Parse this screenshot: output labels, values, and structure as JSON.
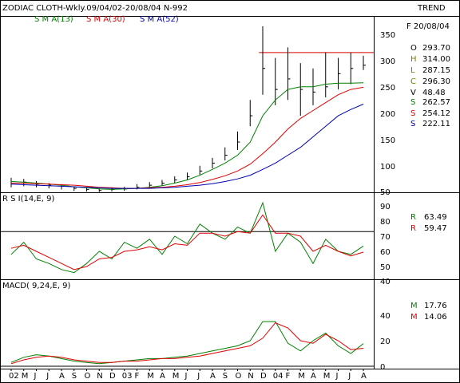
{
  "header": {
    "title": "ZODIAC CLOTH-Wkly.09/04/02-20/08/04  N-992",
    "trend_label": "TREND"
  },
  "colors": {
    "sma13": "#008000",
    "sma30": "#e00000",
    "sma52": "#0000b0",
    "price": "#000000",
    "rsi": "#008000",
    "rsi_signal": "#e00000",
    "macd": "#008000",
    "macd_signal": "#e00000",
    "ref_line": "#d00000"
  },
  "price_panel": {
    "sma_labels": [
      "S M A(13)",
      "S M A(30)",
      "S M A(52)"
    ],
    "ticks": [
      "350",
      "300",
      "250",
      "200",
      "150",
      "100",
      "50"
    ],
    "info": {
      "date": "F 20/08/04",
      "rows": [
        {
          "k": "O",
          "v": "293.70",
          "c": "#000000"
        },
        {
          "k": "H",
          "v": "314.00",
          "c": "#808000"
        },
        {
          "k": "L",
          "v": "287.15",
          "c": "#808000"
        },
        {
          "k": "C",
          "v": "296.30",
          "c": "#808000"
        },
        {
          "k": "V",
          "v": "48.48",
          "c": "#000000"
        },
        {
          "k": "S",
          "v": "262.57",
          "c": "#008000"
        },
        {
          "k": "S",
          "v": "254.12",
          "c": "#e00000"
        },
        {
          "k": "S",
          "v": "222.11",
          "c": "#0000b0"
        }
      ]
    }
  },
  "rsi_panel": {
    "label": "R S I(14,E, 9)",
    "ticks": [
      "90",
      "80",
      "70",
      "60",
      "50",
      "40"
    ],
    "info": [
      {
        "k": "R",
        "v": "63.49",
        "c": "#008000"
      },
      {
        "k": "R",
        "v": "59.47",
        "c": "#e00000"
      }
    ]
  },
  "macd_panel": {
    "label": "MACD( 9,24,E, 9)",
    "ticks": [
      "40",
      "20",
      "0"
    ],
    "info": [
      {
        "k": "M",
        "v": "17.76",
        "c": "#008000"
      },
      {
        "k": "M",
        "v": "14.06",
        "c": "#e00000"
      }
    ]
  },
  "x_axis": {
    "labels": [
      "02",
      "M",
      "J",
      "J",
      "A",
      "S",
      "O",
      "N",
      "D",
      "03",
      "F",
      "M",
      "A",
      "M",
      "J",
      "J",
      "A",
      "S",
      "O",
      "N",
      "D",
      "04",
      "F",
      "M",
      "A",
      "M",
      "J",
      "J",
      "A"
    ]
  },
  "chart_data": {
    "type": "line",
    "title": "ZODIAC CLOTH-Wkly.09/04/02-20/08/04  N-992",
    "x": [
      "02",
      "M",
      "J",
      "J",
      "A",
      "S",
      "O",
      "N",
      "D",
      "03",
      "F",
      "M",
      "A",
      "M",
      "J",
      "J",
      "A",
      "S",
      "O",
      "N",
      "D",
      "04",
      "F",
      "M",
      "A",
      "M",
      "J",
      "J",
      "A"
    ],
    "price": {
      "ylim": [
        50,
        370
      ],
      "close": [
        72,
        74,
        70,
        68,
        66,
        62,
        60,
        58,
        60,
        61,
        64,
        68,
        72,
        78,
        84,
        95,
        110,
        125,
        150,
        200,
        290,
        250,
        270,
        250,
        245,
        255,
        280,
        290,
        296
      ],
      "high": [
        82,
        80,
        76,
        72,
        70,
        66,
        64,
        62,
        64,
        65,
        70,
        74,
        78,
        85,
        92,
        105,
        120,
        140,
        170,
        230,
        370,
        310,
        330,
        300,
        290,
        320,
        310,
        320,
        314
      ],
      "low": [
        64,
        66,
        64,
        62,
        60,
        57,
        56,
        55,
        56,
        57,
        60,
        63,
        67,
        72,
        78,
        88,
        100,
        115,
        135,
        180,
        240,
        220,
        230,
        200,
        220,
        235,
        250,
        260,
        287
      ],
      "reference_level": 320,
      "series": [
        {
          "name": "S M A(13)",
          "values": [
            75,
            74,
            72,
            70,
            68,
            65,
            63,
            61,
            60,
            61,
            62,
            64,
            67,
            72,
            78,
            87,
            98,
            110,
            125,
            150,
            200,
            230,
            250,
            255,
            255,
            260,
            262,
            262,
            262.57
          ]
        },
        {
          "name": "S M A(30)",
          "values": [
            72,
            72,
            71,
            70,
            69,
            68,
            66,
            64,
            63,
            62,
            62,
            63,
            64,
            66,
            69,
            73,
            79,
            86,
            95,
            108,
            128,
            150,
            175,
            195,
            210,
            225,
            240,
            250,
            254.12
          ]
        },
        {
          "name": "S M A(52)",
          "values": [
            70,
            69,
            68,
            67,
            66,
            65,
            64,
            63,
            62,
            62,
            62,
            62,
            63,
            64,
            66,
            68,
            71,
            75,
            80,
            87,
            98,
            110,
            125,
            140,
            160,
            180,
            200,
            212,
            222.11
          ]
        }
      ]
    },
    "rsi": {
      "ylim": [
        40,
        95
      ],
      "reference_level": 73,
      "series": [
        {
          "name": "R",
          "values": [
            58,
            66,
            55,
            52,
            48,
            46,
            52,
            60,
            55,
            66,
            62,
            68,
            58,
            70,
            65,
            78,
            72,
            68,
            76,
            72,
            92,
            60,
            72,
            66,
            52,
            68,
            60,
            58,
            63.49
          ]
        },
        {
          "name": "R",
          "values": [
            62,
            64,
            60,
            56,
            52,
            48,
            50,
            55,
            56,
            60,
            61,
            63,
            61,
            65,
            64,
            72,
            72,
            70,
            73,
            72,
            84,
            72,
            72,
            70,
            60,
            64,
            60,
            57,
            59.47
          ]
        }
      ]
    },
    "macd": {
      "ylim": [
        -3,
        50
      ],
      "series": [
        {
          "name": "M",
          "values": [
            3,
            7,
            9,
            8,
            6,
            4,
            3,
            2,
            3,
            4,
            5,
            6,
            6,
            7,
            8,
            10,
            12,
            14,
            16,
            20,
            35,
            35,
            18,
            12,
            20,
            26,
            16,
            10,
            17.76
          ]
        },
        {
          "name": "M",
          "values": [
            2,
            5,
            7,
            8,
            7,
            5,
            4,
            3,
            3,
            4,
            4,
            5,
            6,
            6,
            7,
            8,
            10,
            12,
            14,
            16,
            22,
            34,
            30,
            20,
            18,
            25,
            20,
            13,
            14.06
          ]
        }
      ]
    }
  }
}
